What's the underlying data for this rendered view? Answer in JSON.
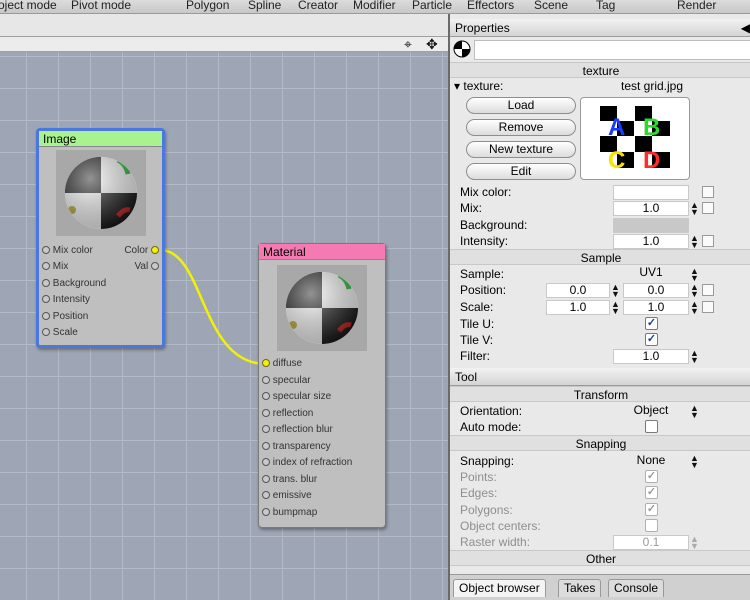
{
  "menubar": [
    "oject mode",
    "Pivot mode",
    "Polygon",
    "Spline",
    "Creator",
    "Modifier",
    "Particle",
    "Effectors",
    "Scene",
    "Tag",
    "Render"
  ],
  "nodes": {
    "image": {
      "title": "Image",
      "title_color": "#a8f28f",
      "ports_in": [
        "Mix color",
        "Mix",
        "Background",
        "Intensity",
        "Position",
        "Scale"
      ],
      "ports_out": [
        "Color",
        "Val"
      ]
    },
    "material": {
      "title": "Material",
      "title_color": "#f57ab3",
      "ports_in": [
        "diffuse",
        "specular",
        "specular size",
        "reflection",
        "reflection blur",
        "transparency",
        "index of refraction",
        "trans. blur",
        "emissive",
        "bumpmap"
      ]
    },
    "connection_color": "#f5f000"
  },
  "properties": {
    "header": "Properties",
    "texture_section": "texture",
    "texture_label": "texture:",
    "texture_file": "test grid.jpg",
    "buttons": [
      "Load",
      "Remove",
      "New texture",
      "Edit"
    ],
    "preview_letters": [
      "A",
      "B",
      "C",
      "D"
    ],
    "rows": {
      "mix_color": "Mix color:",
      "mix": "Mix:",
      "mix_value": "1.0",
      "background": "Background:",
      "intensity": "Intensity:",
      "intensity_value": "1.0"
    },
    "sample_section": "Sample",
    "sample": {
      "sample_label": "Sample:",
      "sample_value": "UV1",
      "position_label": "Position:",
      "position_values": [
        "0.0",
        "0.0"
      ],
      "scale_label": "Scale:",
      "scale_values": [
        "1.0",
        "1.0"
      ],
      "tile_u": "Tile U:",
      "tile_v": "Tile V:",
      "filter_label": "Filter:",
      "filter_value": "1.0"
    }
  },
  "tool": {
    "header": "Tool",
    "transform_section": "Transform",
    "orientation_label": "Orientation:",
    "orientation_value": "Object",
    "auto_mode_label": "Auto mode:",
    "snapping_section": "Snapping",
    "snapping_label": "Snapping:",
    "snapping_value": "None",
    "points": "Points:",
    "edges": "Edges:",
    "polygons": "Polygons:",
    "object_centers": "Object centers:",
    "raster_width": "Raster width:",
    "raster_value": "0.1",
    "other_section": "Other"
  },
  "tabs": [
    "Object browser",
    "Takes",
    "Console"
  ],
  "colors": {
    "selection": "#4a78e0",
    "panel": "#e9e9e9",
    "grid": "#9ea6b6"
  }
}
